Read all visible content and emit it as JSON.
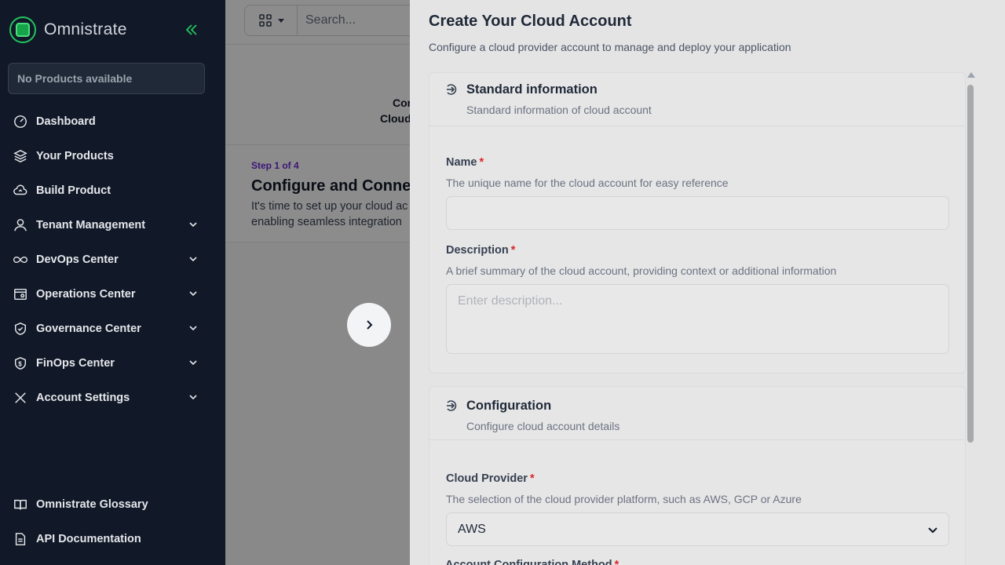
{
  "sidebar": {
    "brand": "Omnistrate",
    "product_box": "No Products available",
    "items": [
      {
        "label": "Dashboard",
        "icon": "gauge-icon"
      },
      {
        "label": "Your Products",
        "icon": "layers-icon"
      },
      {
        "label": "Build Product",
        "icon": "cloud-upload-icon"
      },
      {
        "label": "Tenant Management",
        "icon": "user-icon"
      },
      {
        "label": "DevOps Center",
        "icon": "infinity-icon"
      },
      {
        "label": "Operations Center",
        "icon": "window-gear-icon"
      },
      {
        "label": "Governance Center",
        "icon": "shield-check-icon"
      },
      {
        "label": "FinOps Center",
        "icon": "shield-dollar-icon"
      },
      {
        "label": "Account Settings",
        "icon": "tools-icon"
      }
    ],
    "bottom": [
      {
        "label": "Omnistrate Glossary",
        "icon": "book-icon"
      },
      {
        "label": "API Documentation",
        "icon": "document-icon"
      }
    ]
  },
  "main": {
    "search_placeholder": "Search...",
    "partial_top_1": "Cor",
    "partial_top_2": "Cloud",
    "step_label": "Step 1 of 4",
    "step_title": "Configure and Conne",
    "step_desc_1": "It's time to set up your cloud ac",
    "step_desc_2": "enabling seamless integration"
  },
  "drawer": {
    "title": "Create Your Cloud Account",
    "subtitle": "Configure a cloud provider account to manage and deploy your application",
    "standard": {
      "title": "Standard information",
      "subtitle": "Standard information of cloud account",
      "name_label": "Name",
      "name_help": "The unique name for the cloud account for easy reference",
      "name_value": "",
      "desc_label": "Description",
      "desc_help": "A brief summary of the cloud account, providing context or additional information",
      "desc_placeholder": "Enter description..."
    },
    "config": {
      "title": "Configuration",
      "subtitle": "Configure cloud account details",
      "provider_label": "Cloud Provider",
      "provider_help": "The selection of the cloud provider platform, such as AWS, GCP or Azure",
      "provider_value": "AWS",
      "method_label": "Account Configuration Method"
    },
    "required_mark": "*"
  },
  "colors": {
    "sidebar_bg": "#111827",
    "brand_green": "#22c55e",
    "step_purple": "#6d28d9",
    "required_red": "#dc2626"
  }
}
